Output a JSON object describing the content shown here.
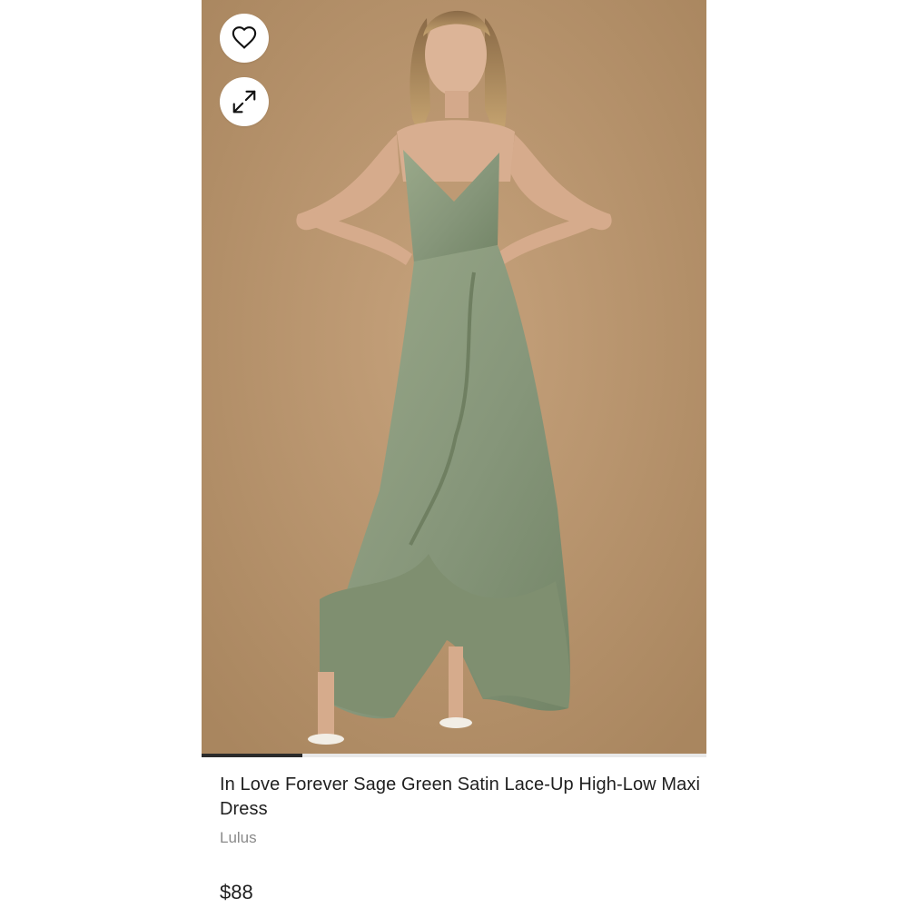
{
  "product": {
    "title": "In Love Forever Sage Green Satin Lace-Up High-Low Maxi Dress",
    "brand": "Lulus",
    "price": "$88",
    "image_progress_fraction": 0.2
  },
  "buttons": {
    "favorite_icon": "heart-icon",
    "expand_icon": "expand-icon"
  },
  "colors": {
    "photo_background": "#b8946f",
    "dress": "#8a9a78"
  }
}
